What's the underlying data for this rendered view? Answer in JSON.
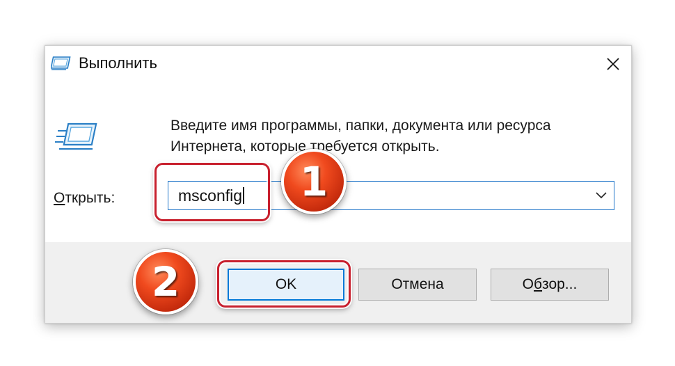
{
  "window": {
    "title": "Выполнить",
    "icon": "run-dialog-icon"
  },
  "description": "Введите имя программы, папки, документа или ресурса Интернета, которые требуется открыть.",
  "open_field": {
    "label_accel": "О",
    "label_rest": "ткрыть:",
    "value": "msconfig"
  },
  "buttons": {
    "ok": "OK",
    "cancel": "Отмена",
    "browse_accel": "б",
    "browse_prefix": "О",
    "browse_rest": "зор..."
  },
  "annotations": {
    "step1": "1",
    "step2": "2",
    "highlight_color": "#c8202e",
    "badge_color": "#e8431b"
  },
  "colors": {
    "focus_border": "#0078d7",
    "footer_bg": "#f0f0f0"
  }
}
